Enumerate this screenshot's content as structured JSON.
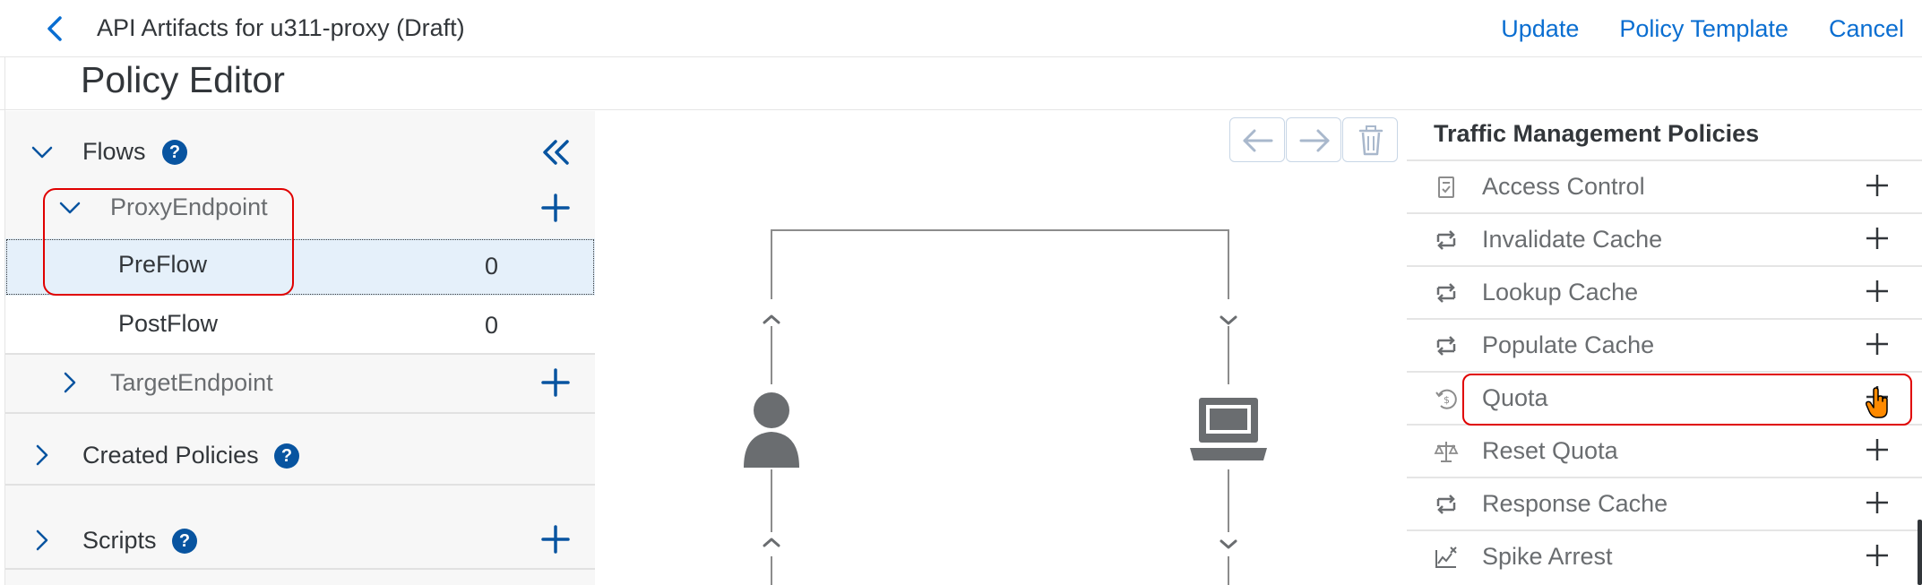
{
  "header": {
    "title": "API Artifacts for u311-proxy (Draft)",
    "back_icon": "chevron-left-icon",
    "actions": {
      "update": "Update",
      "policy_template": "Policy Template",
      "cancel": "Cancel"
    },
    "link_color": "#0a6ed1"
  },
  "page": {
    "title": "Policy Editor"
  },
  "left_panel": {
    "flows": {
      "label": "Flows",
      "help": "?"
    },
    "proxy_endpoint": {
      "label": "ProxyEndpoint"
    },
    "preflow": {
      "label": "PreFlow",
      "count": "0"
    },
    "postflow": {
      "label": "PostFlow",
      "count": "0"
    },
    "target_endpoint": {
      "label": "TargetEndpoint"
    },
    "created_policies": {
      "label": "Created Policies",
      "help": "?"
    },
    "scripts": {
      "label": "Scripts",
      "help": "?"
    },
    "accent_color": "#0854a0"
  },
  "canvas": {
    "toolbar": [
      "arrow-left-icon",
      "arrow-right-icon",
      "trash-icon"
    ],
    "icons": [
      "user-icon",
      "laptop-icon"
    ]
  },
  "right_panel": {
    "heading": "Traffic Management Policies",
    "policies": [
      {
        "label": "Access Control",
        "icon": "document-icon"
      },
      {
        "label": "Invalidate Cache",
        "icon": "cache-icon"
      },
      {
        "label": "Lookup Cache",
        "icon": "cache-icon"
      },
      {
        "label": "Populate Cache",
        "icon": "cache-icon"
      },
      {
        "label": "Quota",
        "icon": "quota-icon"
      },
      {
        "label": "Reset Quota",
        "icon": "scale-icon"
      },
      {
        "label": "Response Cache",
        "icon": "cache-icon"
      },
      {
        "label": "Spike Arrest",
        "icon": "spike-icon"
      }
    ]
  },
  "highlight_color": "#e00000"
}
